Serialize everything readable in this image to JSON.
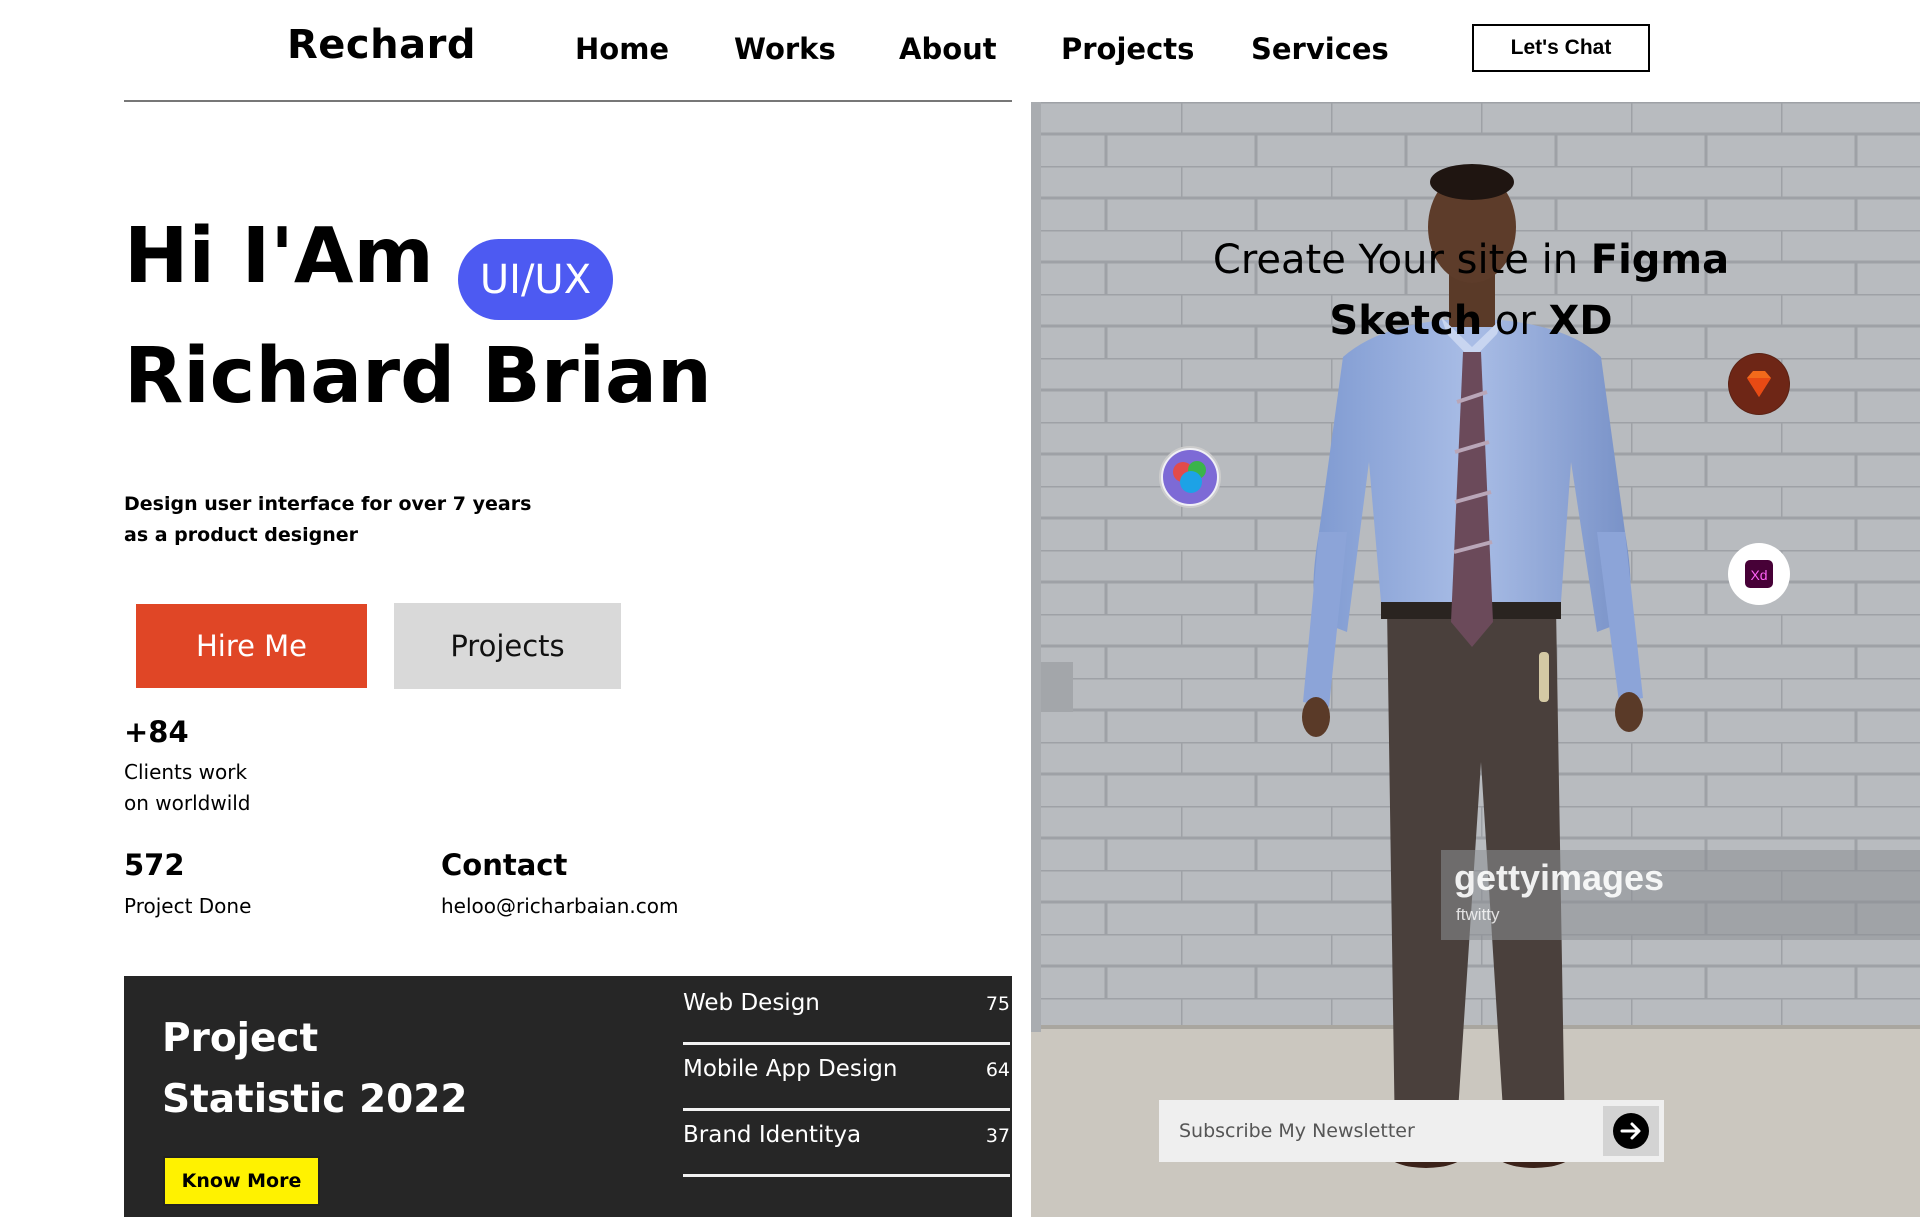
{
  "header": {
    "logo": "Rechard",
    "nav": [
      "Home",
      "Works",
      "About",
      "Projects",
      "Services"
    ],
    "cta_label": "Let's Chat"
  },
  "hero": {
    "greeting": "Hi I'Am",
    "role_badge": "UI/UX",
    "name": "Richard Brian",
    "description_line1": "Design user interface for over 7 years",
    "description_line2": "as a product designer",
    "hire_label": "Hire Me",
    "projects_label": "Projects"
  },
  "stats": {
    "clients_value": "+84",
    "clients_label_1": "Clients work",
    "clients_label_2": "on worldwild",
    "projects_value": "572",
    "projects_label": "Project Done",
    "contact_title": "Contact",
    "contact_email": "heloo@richarbaian.com"
  },
  "statistics_panel": {
    "title_line1": "Project",
    "title_line2": "Statistic 2022",
    "know_more_label": "Know More",
    "items": [
      {
        "name": "Web Design",
        "value": "75"
      },
      {
        "name": "Mobile App Design",
        "value": "64"
      },
      {
        "name": "Brand Identitya",
        "value": "37"
      }
    ]
  },
  "promo": {
    "text_1": "Create Your site in ",
    "tool_1": "Figma",
    "tool_2": "Sketch",
    "text_or": " or ",
    "tool_3": "XD",
    "icons": [
      "figma-icon",
      "sketch-icon",
      "xd-icon"
    ],
    "watermark": "gettyimages",
    "watermark_credit": "ftwitty"
  },
  "newsletter": {
    "placeholder": "Subscribe My Newsletter"
  },
  "colors": {
    "accent_blue": "#4d5af2",
    "hire_red": "#e04626",
    "panel_dark": "#262626",
    "know_yellow": "#fff200"
  }
}
